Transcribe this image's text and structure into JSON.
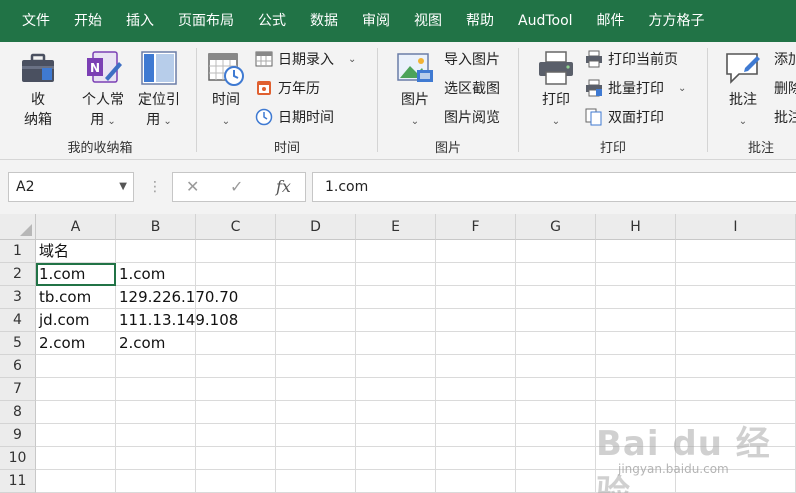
{
  "menu": {
    "tabs": [
      "文件",
      "开始",
      "插入",
      "页面布局",
      "公式",
      "数据",
      "审阅",
      "视图",
      "帮助",
      "AudTool",
      "邮件",
      "方方格子"
    ]
  },
  "ribbon": {
    "group_storage": {
      "label": "我的收纳箱",
      "storage_btn": "收\n纳箱",
      "personal_btn": "个人常\n用",
      "locate_btn": "定位引\n用"
    },
    "group_time": {
      "label": "时间",
      "time_btn": "时间",
      "date_entry": "日期录入",
      "calendar": "万年历",
      "datetime": "日期时间"
    },
    "group_image": {
      "label": "图片",
      "image_btn": "图片",
      "import_image": "导入图片",
      "select_capture": "选区截图",
      "image_browse": "图片阅览"
    },
    "group_print": {
      "label": "打印",
      "print_btn": "打印",
      "print_current": "打印当前页",
      "batch_print": "批量打印",
      "duplex_print": "双面打印"
    },
    "group_comment": {
      "label": "批注",
      "comment_btn": "批注",
      "add": "添加",
      "delete": "删除",
      "more": "批注"
    }
  },
  "formula_bar": {
    "name_box": "A2",
    "formula_value": "1.com",
    "fx_label": "fx"
  },
  "sheet": {
    "columns": [
      "A",
      "B",
      "C",
      "D",
      "E",
      "F",
      "G",
      "H",
      "I"
    ],
    "rows": [
      "1",
      "2",
      "3",
      "4",
      "5",
      "6",
      "7",
      "8",
      "9",
      "10",
      "11"
    ],
    "cells": {
      "A1": "域名",
      "A2": "1.com",
      "B2": "1.com",
      "A3": "tb.com",
      "B3": "129.226.170.70",
      "A4": "jd.com",
      "B4": "111.13.149.108",
      "A5": "2.com",
      "B5": "2.com"
    },
    "selected_cell": "A2"
  },
  "watermark": {
    "brand": "Bai du 经验",
    "url": "jingyan.baidu.com"
  },
  "colors": {
    "accent": "#217346",
    "ribbon_bg": "#f3f3f3",
    "grid_line": "#dadada"
  }
}
